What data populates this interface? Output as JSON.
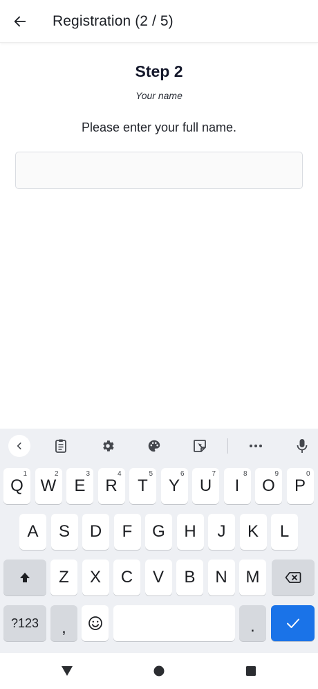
{
  "appbar": {
    "title": "Registration (2 / 5)"
  },
  "content": {
    "step_title": "Step 2",
    "step_subtitle": "Your name",
    "instructions": "Please enter your full name.",
    "name_input": {
      "value": "",
      "placeholder": ""
    }
  },
  "keyboard": {
    "row1": [
      {
        "label": "Q",
        "hint": "1"
      },
      {
        "label": "W",
        "hint": "2"
      },
      {
        "label": "E",
        "hint": "3"
      },
      {
        "label": "R",
        "hint": "4"
      },
      {
        "label": "T",
        "hint": "5"
      },
      {
        "label": "Y",
        "hint": "6"
      },
      {
        "label": "U",
        "hint": "7"
      },
      {
        "label": "I",
        "hint": "8"
      },
      {
        "label": "O",
        "hint": "9"
      },
      {
        "label": "P",
        "hint": "0"
      }
    ],
    "row2": [
      "A",
      "S",
      "D",
      "F",
      "G",
      "H",
      "J",
      "K",
      "L"
    ],
    "row3": [
      "Z",
      "X",
      "C",
      "V",
      "B",
      "N",
      "M"
    ],
    "symbols_label": "?123",
    "comma_label": ",",
    "period_label": ".",
    "toolbar_icons": [
      "chevron-left-icon",
      "clipboard-icon",
      "gear-icon",
      "palette-icon",
      "sticker-icon",
      "more-icon",
      "mic-icon"
    ],
    "accent_color": "#1a73e8"
  },
  "navbar": {
    "icons": [
      "back-triangle-icon",
      "home-circle-icon",
      "recents-square-icon"
    ]
  }
}
